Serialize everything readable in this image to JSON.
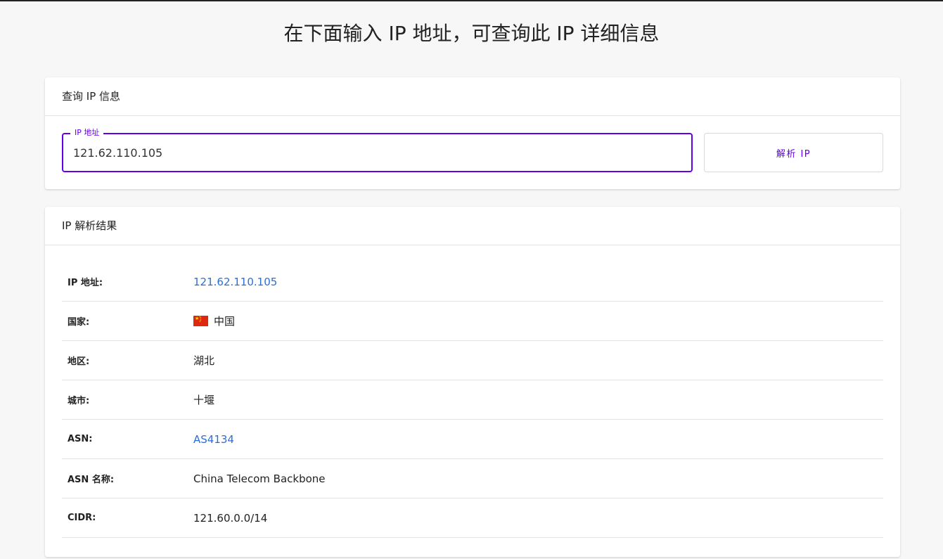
{
  "page": {
    "title": "在下面输入 IP 地址，可查询此 IP 详细信息"
  },
  "query": {
    "header": "查询 IP 信息",
    "field_label": "IP 地址",
    "input_value": "121.62.110.105",
    "button_label": "解析 IP",
    "accent_color": "#6200ea"
  },
  "result": {
    "header": "IP 解析结果",
    "rows": [
      {
        "label": "IP 地址:",
        "value": "121.62.110.105"
      },
      {
        "label": "国家:",
        "value": "中国",
        "icon": "china-flag-icon"
      },
      {
        "label": "地区:",
        "value": "湖北"
      },
      {
        "label": "城市:",
        "value": "十堰"
      },
      {
        "label": "ASN:",
        "value": "AS4134"
      },
      {
        "label": "ASN 名称:",
        "value": "China Telecom Backbone"
      },
      {
        "label": "CIDR:",
        "value": "121.60.0.0/14"
      }
    ],
    "link_color": "#2a6fd6"
  }
}
